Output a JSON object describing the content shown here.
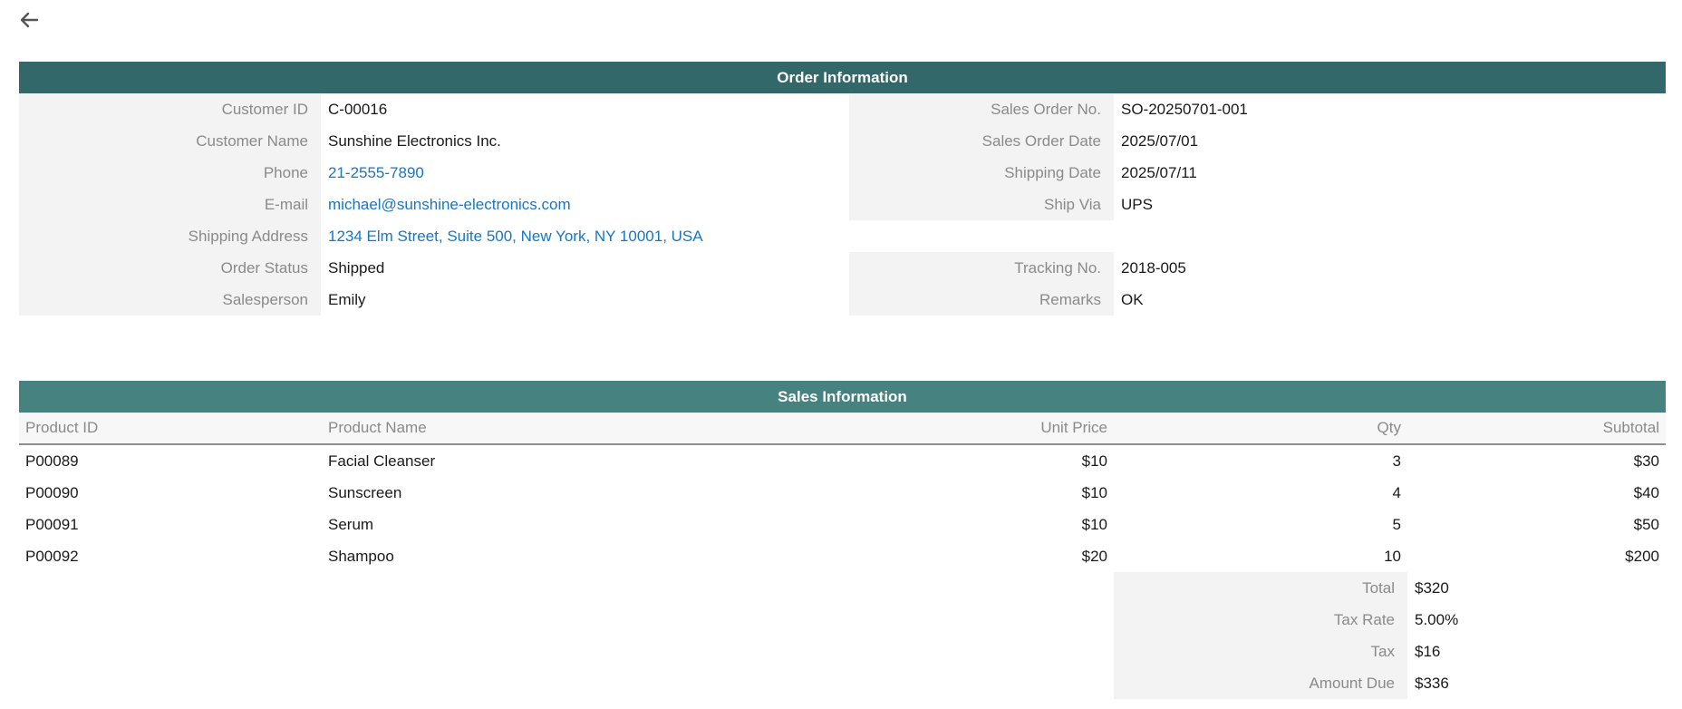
{
  "nav": {
    "back_icon": "arrow-left-icon"
  },
  "order": {
    "title": "Order Information",
    "left": [
      {
        "label": "Customer ID",
        "value": "C-00016",
        "link": false
      },
      {
        "label": "Customer Name",
        "value": "Sunshine Electronics Inc.",
        "link": false
      },
      {
        "label": "Phone",
        "value": "21-2555-7890",
        "link": true
      },
      {
        "label": "E-mail",
        "value": "michael@sunshine-electronics.com",
        "link": true
      },
      {
        "label": "Shipping Address",
        "value": "1234 Elm Street, Suite 500, New York, NY 10001, USA",
        "link": true
      },
      {
        "label": "Order Status",
        "value": "Shipped",
        "link": false
      },
      {
        "label": "Salesperson",
        "value": "Emily",
        "link": false
      }
    ],
    "right": [
      {
        "label": "Sales Order No.",
        "value": "SO-20250701-001"
      },
      {
        "label": "Sales Order Date",
        "value": "2025/07/01"
      },
      {
        "label": "Shipping Date",
        "value": "2025/07/11"
      },
      {
        "label": "Ship Via",
        "value": "UPS"
      },
      null,
      {
        "label": "Tracking No.",
        "value": "2018-005"
      },
      {
        "label": "Remarks",
        "value": "OK"
      }
    ]
  },
  "sales": {
    "title": "Sales Information",
    "columns": {
      "product_id": "Product ID",
      "product_name": "Product Name",
      "unit_price": "Unit Price",
      "qty": "Qty",
      "subtotal": "Subtotal"
    },
    "rows": [
      {
        "product_id": "P00089",
        "product_name": "Facial Cleanser",
        "unit_price": "$10",
        "qty": "3",
        "subtotal": "$30"
      },
      {
        "product_id": "P00090",
        "product_name": "Sunscreen",
        "unit_price": "$10",
        "qty": "4",
        "subtotal": "$40"
      },
      {
        "product_id": "P00091",
        "product_name": "Serum",
        "unit_price": "$10",
        "qty": "5",
        "subtotal": "$50"
      },
      {
        "product_id": "P00092",
        "product_name": "Shampoo",
        "unit_price": "$20",
        "qty": "10",
        "subtotal": "$200"
      }
    ],
    "totals": [
      {
        "label": "Total",
        "value": "$320"
      },
      {
        "label": "Tax Rate",
        "value": "5.00%"
      },
      {
        "label": "Tax",
        "value": "$16"
      },
      {
        "label": "Amount Due",
        "value": "$336"
      }
    ]
  },
  "colors": {
    "order_header": "#33686b",
    "sales_header": "#458280",
    "link": "#1976c2",
    "label_bg": "#f3f3f3"
  }
}
